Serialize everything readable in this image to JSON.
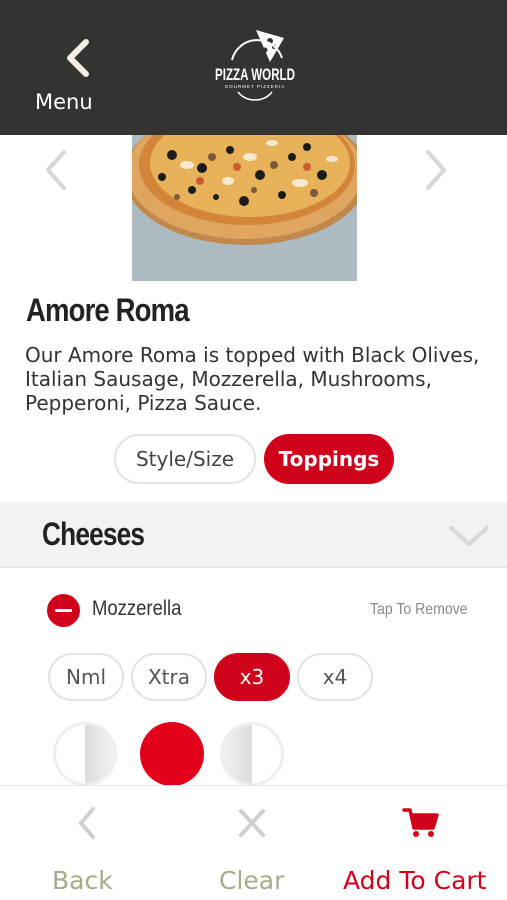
{
  "header": {
    "menu_label": "Menu",
    "logo_text": "PIZZA WORLD",
    "logo_subtext": "GOURMET PIZZERIA"
  },
  "product": {
    "title": "Amore Roma",
    "description": "Our Amore Roma is topped with Black Olives, Italian Sausage, Mozzerella, Mushrooms, Pepperoni, Pizza Sauce."
  },
  "tabs": [
    {
      "label": "Style/Size",
      "active": false
    },
    {
      "label": "Toppings",
      "active": true
    }
  ],
  "section": {
    "title": "Cheeses",
    "expanded": true
  },
  "topping": {
    "name": "Mozzerella",
    "hint": "Tap To Remove",
    "quantities": [
      "Nml",
      "Xtra",
      "x3",
      "x4"
    ],
    "selected_quantity": "x3",
    "portions": [
      "left-half",
      "whole",
      "right-half"
    ],
    "selected_portion": "whole"
  },
  "bottom_bar": {
    "back_label": "Back",
    "clear_label": "Clear",
    "cart_label": "Add To Cart"
  },
  "colors": {
    "header_bg": "#333331",
    "accent": "#d0021b",
    "muted_label": "#a9a98a",
    "icon_gray": "#cfcfcf"
  },
  "icons": {
    "back": "chevron-left-icon",
    "carousel_prev": "chevron-left-icon",
    "carousel_next": "chevron-right-icon",
    "section_toggle": "chevron-down-icon",
    "remove": "minus-circle-icon",
    "clear": "x-icon",
    "cart": "shopping-cart-icon"
  }
}
